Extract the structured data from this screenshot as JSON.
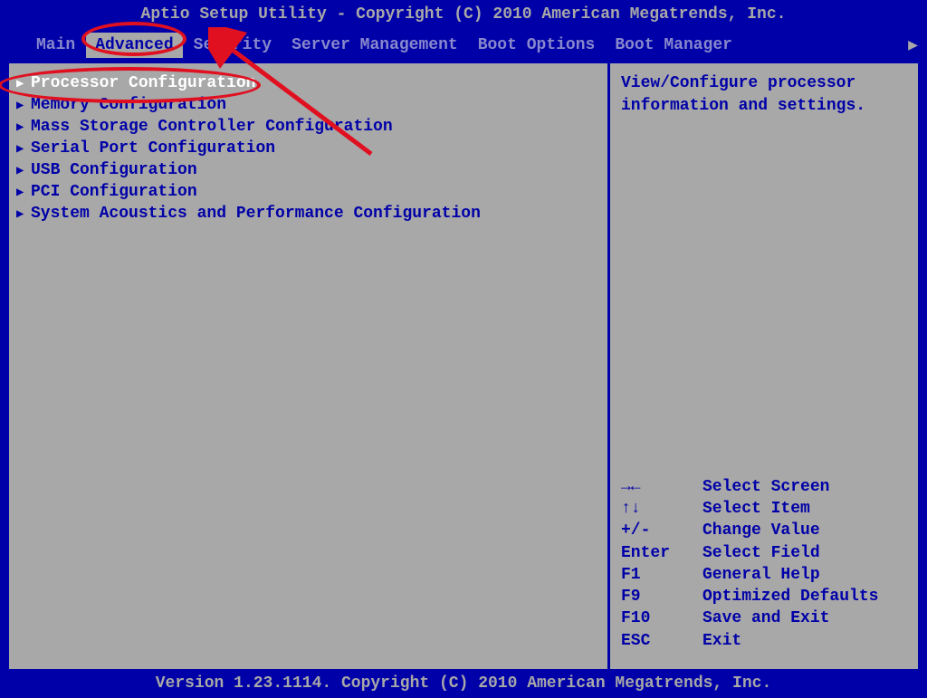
{
  "header": {
    "title": "Aptio Setup Utility - Copyright (C) 2010 American Megatrends, Inc."
  },
  "tabs": [
    {
      "label": "Main",
      "active": false
    },
    {
      "label": "Advanced",
      "active": true
    },
    {
      "label": "Security",
      "active": false
    },
    {
      "label": "Server Management",
      "active": false
    },
    {
      "label": "Boot Options",
      "active": false
    },
    {
      "label": "Boot Manager",
      "active": false
    }
  ],
  "menu_items": [
    {
      "label": "Processor Configuration",
      "selected": true
    },
    {
      "label": "Memory Configuration",
      "selected": false
    },
    {
      "label": "Mass Storage Controller Configuration",
      "selected": false
    },
    {
      "label": "Serial Port Configuration",
      "selected": false
    },
    {
      "label": "USB Configuration",
      "selected": false
    },
    {
      "label": "PCI Configuration",
      "selected": false
    },
    {
      "label": "System Acoustics and Performance Configuration",
      "selected": false
    }
  ],
  "help_text": "View/Configure processor information and settings.",
  "key_hints": [
    {
      "key": "→←",
      "action": "Select Screen"
    },
    {
      "key": "↑↓",
      "action": "Select Item"
    },
    {
      "key": "+/-",
      "action": "Change Value"
    },
    {
      "key": "Enter",
      "action": "Select Field"
    },
    {
      "key": "F1",
      "action": "General Help"
    },
    {
      "key": "F9",
      "action": "Optimized Defaults"
    },
    {
      "key": "F10",
      "action": "Save and Exit"
    },
    {
      "key": "ESC",
      "action": "Exit"
    }
  ],
  "footer": {
    "version": "Version 1.23.1114. Copyright (C) 2010 American Megatrends, Inc."
  }
}
